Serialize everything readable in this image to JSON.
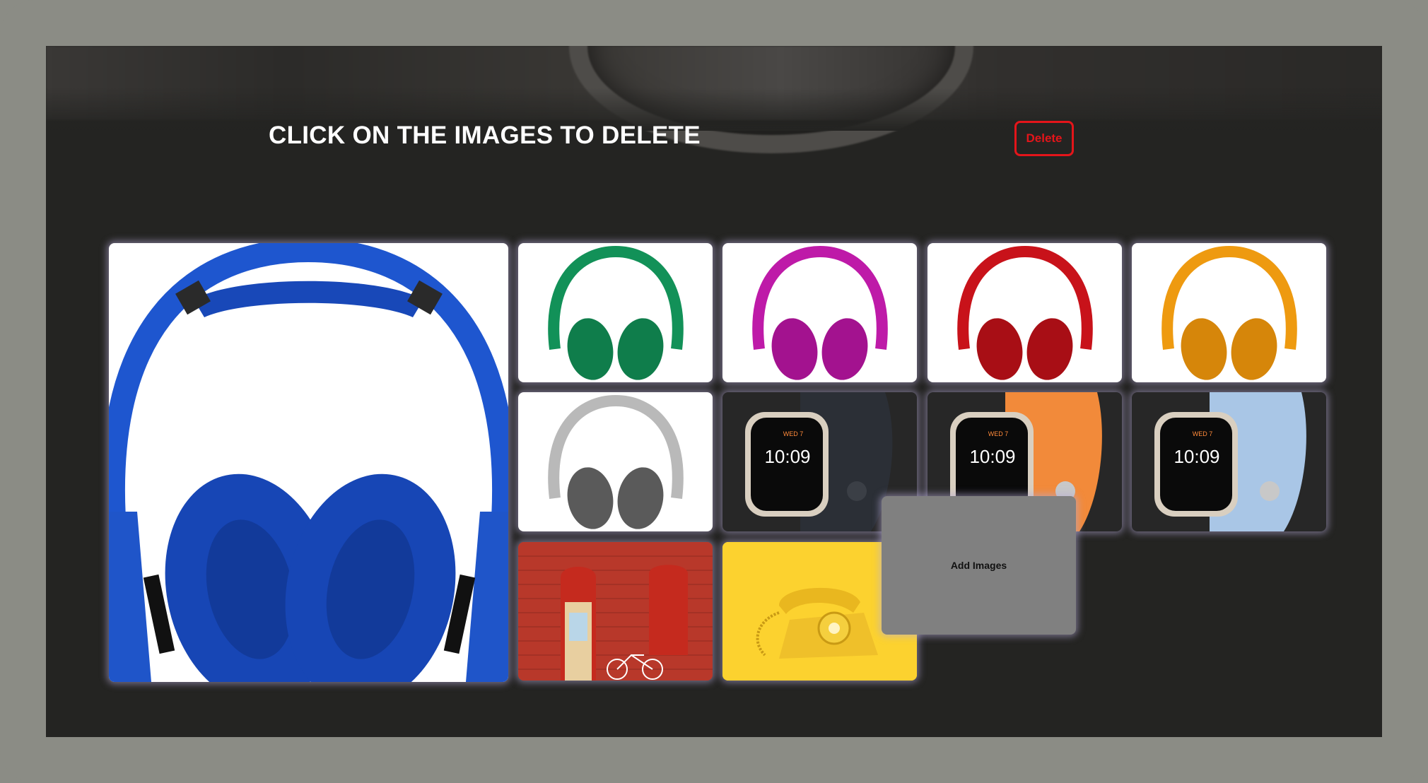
{
  "page": {
    "heading": "CLICK ON THE IMAGES TO DELETE",
    "delete_label": "Delete",
    "add_label": "Add Images"
  },
  "gallery": {
    "images": [
      {
        "subject": "headphones",
        "color": "#1c4fc6"
      },
      {
        "subject": "headphones",
        "color": "#129158"
      },
      {
        "subject": "headphones",
        "color": "#be1aa8"
      },
      {
        "subject": "headphones",
        "color": "#c8121a"
      },
      {
        "subject": "headphones",
        "color": "#ee9a10"
      },
      {
        "subject": "headphones",
        "color": "#b9b9b9"
      },
      {
        "subject": "smartwatch",
        "color": "#2b2f36",
        "time": "10:09",
        "day": "WED 7"
      },
      {
        "subject": "smartwatch",
        "color": "#f28a3a",
        "time": "10:09",
        "day": "WED 7"
      },
      {
        "subject": "smartwatch",
        "color": "#a9c6e6",
        "time": "10:09",
        "day": "WED 7"
      },
      {
        "subject": "red-brick-wall-bicycle",
        "color": "#b8382a"
      },
      {
        "subject": "yellow-rotary-phone",
        "color": "#fcd22f"
      }
    ]
  },
  "colors": {
    "accent": "#e4151a",
    "background": "#242422",
    "frame": "#8b8c85",
    "add_tile": "#808080"
  }
}
